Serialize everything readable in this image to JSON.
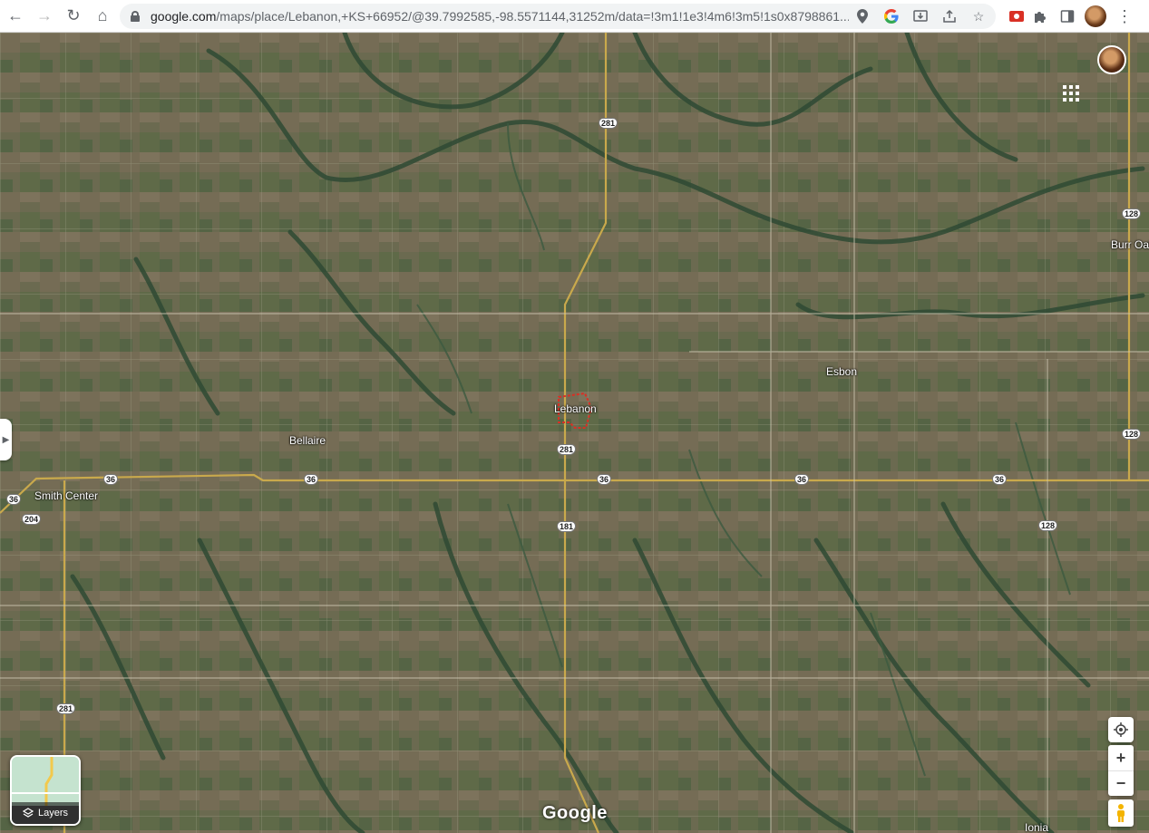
{
  "browser": {
    "url_host": "google.com",
    "url_rest": "/maps/place/Lebanon,+KS+66952/@39.7992585,-98.5571144,31252m/data=!3m1!1e3!4m6!3m5!1s0x8798861..."
  },
  "icons": {
    "back": "arrow-left-icon",
    "forward": "arrow-right-icon",
    "reload": "reload-icon",
    "home": "home-icon",
    "lock": "lock-icon",
    "location": "location-pin-icon",
    "google": "google-g-icon",
    "install": "install-icon",
    "share": "share-icon",
    "bookmark": "star-icon",
    "extension_red": "red-extension-icon",
    "extensions": "puzzle-icon",
    "sidepanel": "side-panel-icon",
    "profile": "profile-avatar-icon",
    "menu": "kebab-menu-icon"
  },
  "map": {
    "places": [
      {
        "name": "Lebanon"
      },
      {
        "name": "Esbon"
      },
      {
        "name": "Bellaire"
      },
      {
        "name": "Smith Center"
      },
      {
        "name": "Burr Oak"
      },
      {
        "name": "Ionia"
      }
    ],
    "shields": [
      "281",
      "128",
      "281",
      "36",
      "36",
      "36",
      "36",
      "36",
      "36",
      "128",
      "204",
      "181",
      "128",
      "281"
    ],
    "layers_label": "Layers",
    "google_logo": "Google"
  },
  "colors": {
    "accent_red": "#d93025",
    "satellite_base": "#5b6248"
  }
}
